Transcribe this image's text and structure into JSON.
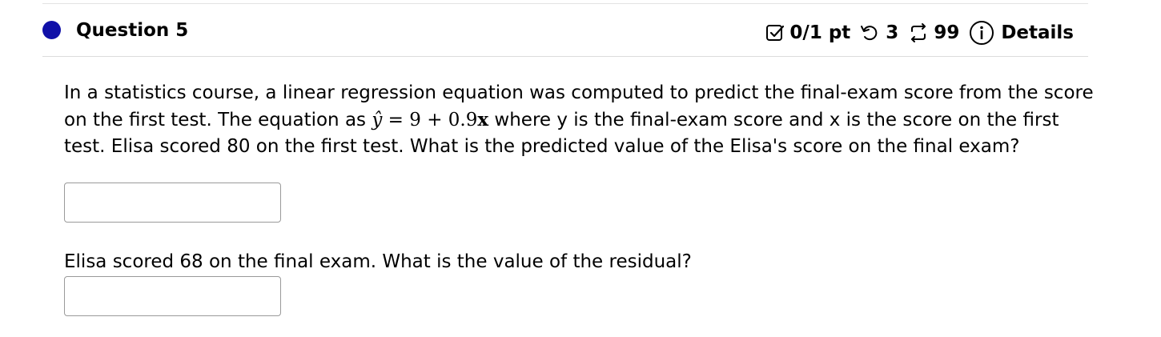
{
  "question": {
    "title": "Question 5",
    "status_dot_color": "#1010a8",
    "score": "0/1 pt",
    "retries": "3",
    "submissions": "99",
    "details": "Details",
    "icons": [
      "checkbox-icon",
      "retry-icon",
      "submissions-icon",
      "info-icon"
    ]
  },
  "body": {
    "text_before_equation": "In a statistics course, a linear regression equation was computed to predict the final-exam score from the score on the first test. The equation as ",
    "equation": {
      "lhs": "ŷ",
      "equals": "=",
      "rhs_const": "9",
      "plus": "+",
      "rhs_coef": "0.9",
      "rhs_var": "x"
    },
    "text_after_equation": " where y is the final-exam score and x is the score on the first test. Elisa scored 80 on the first test. What is the predicted value of the Elisa's score on the final exam?",
    "answer1_value": "",
    "question2": "Elisa scored 68 on the final exam. What is the value of the residual?",
    "answer2_value": ""
  }
}
